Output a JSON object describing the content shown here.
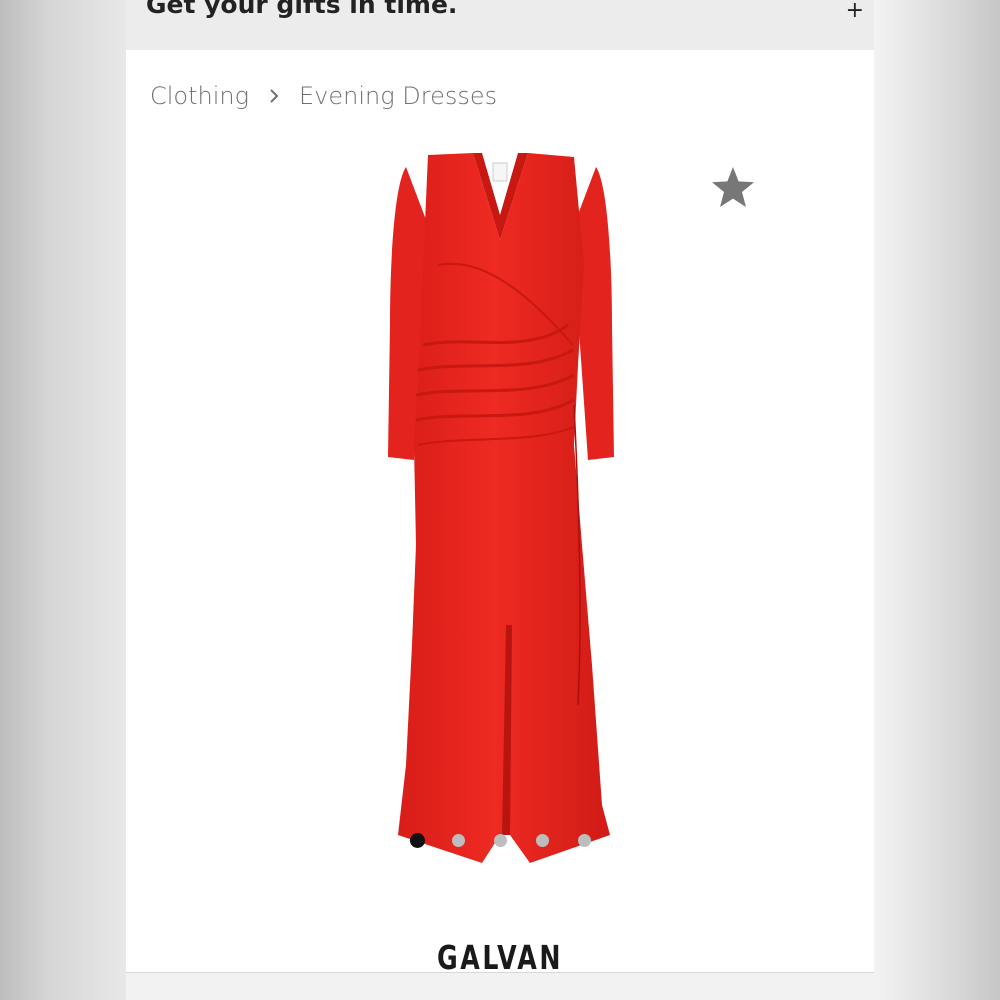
{
  "banner": {
    "text": "Get your gifts in time.",
    "expand_label": "+"
  },
  "breadcrumb": {
    "items": [
      "Clothing",
      "Evening Dresses"
    ]
  },
  "product": {
    "brand": "GALVAN",
    "image_icon": "red-evening-dress",
    "image_count": 5,
    "active_image_index": 0,
    "dress_color": "#e9261f",
    "favorite_icon": "star-icon",
    "favorite_color": "#777777"
  }
}
